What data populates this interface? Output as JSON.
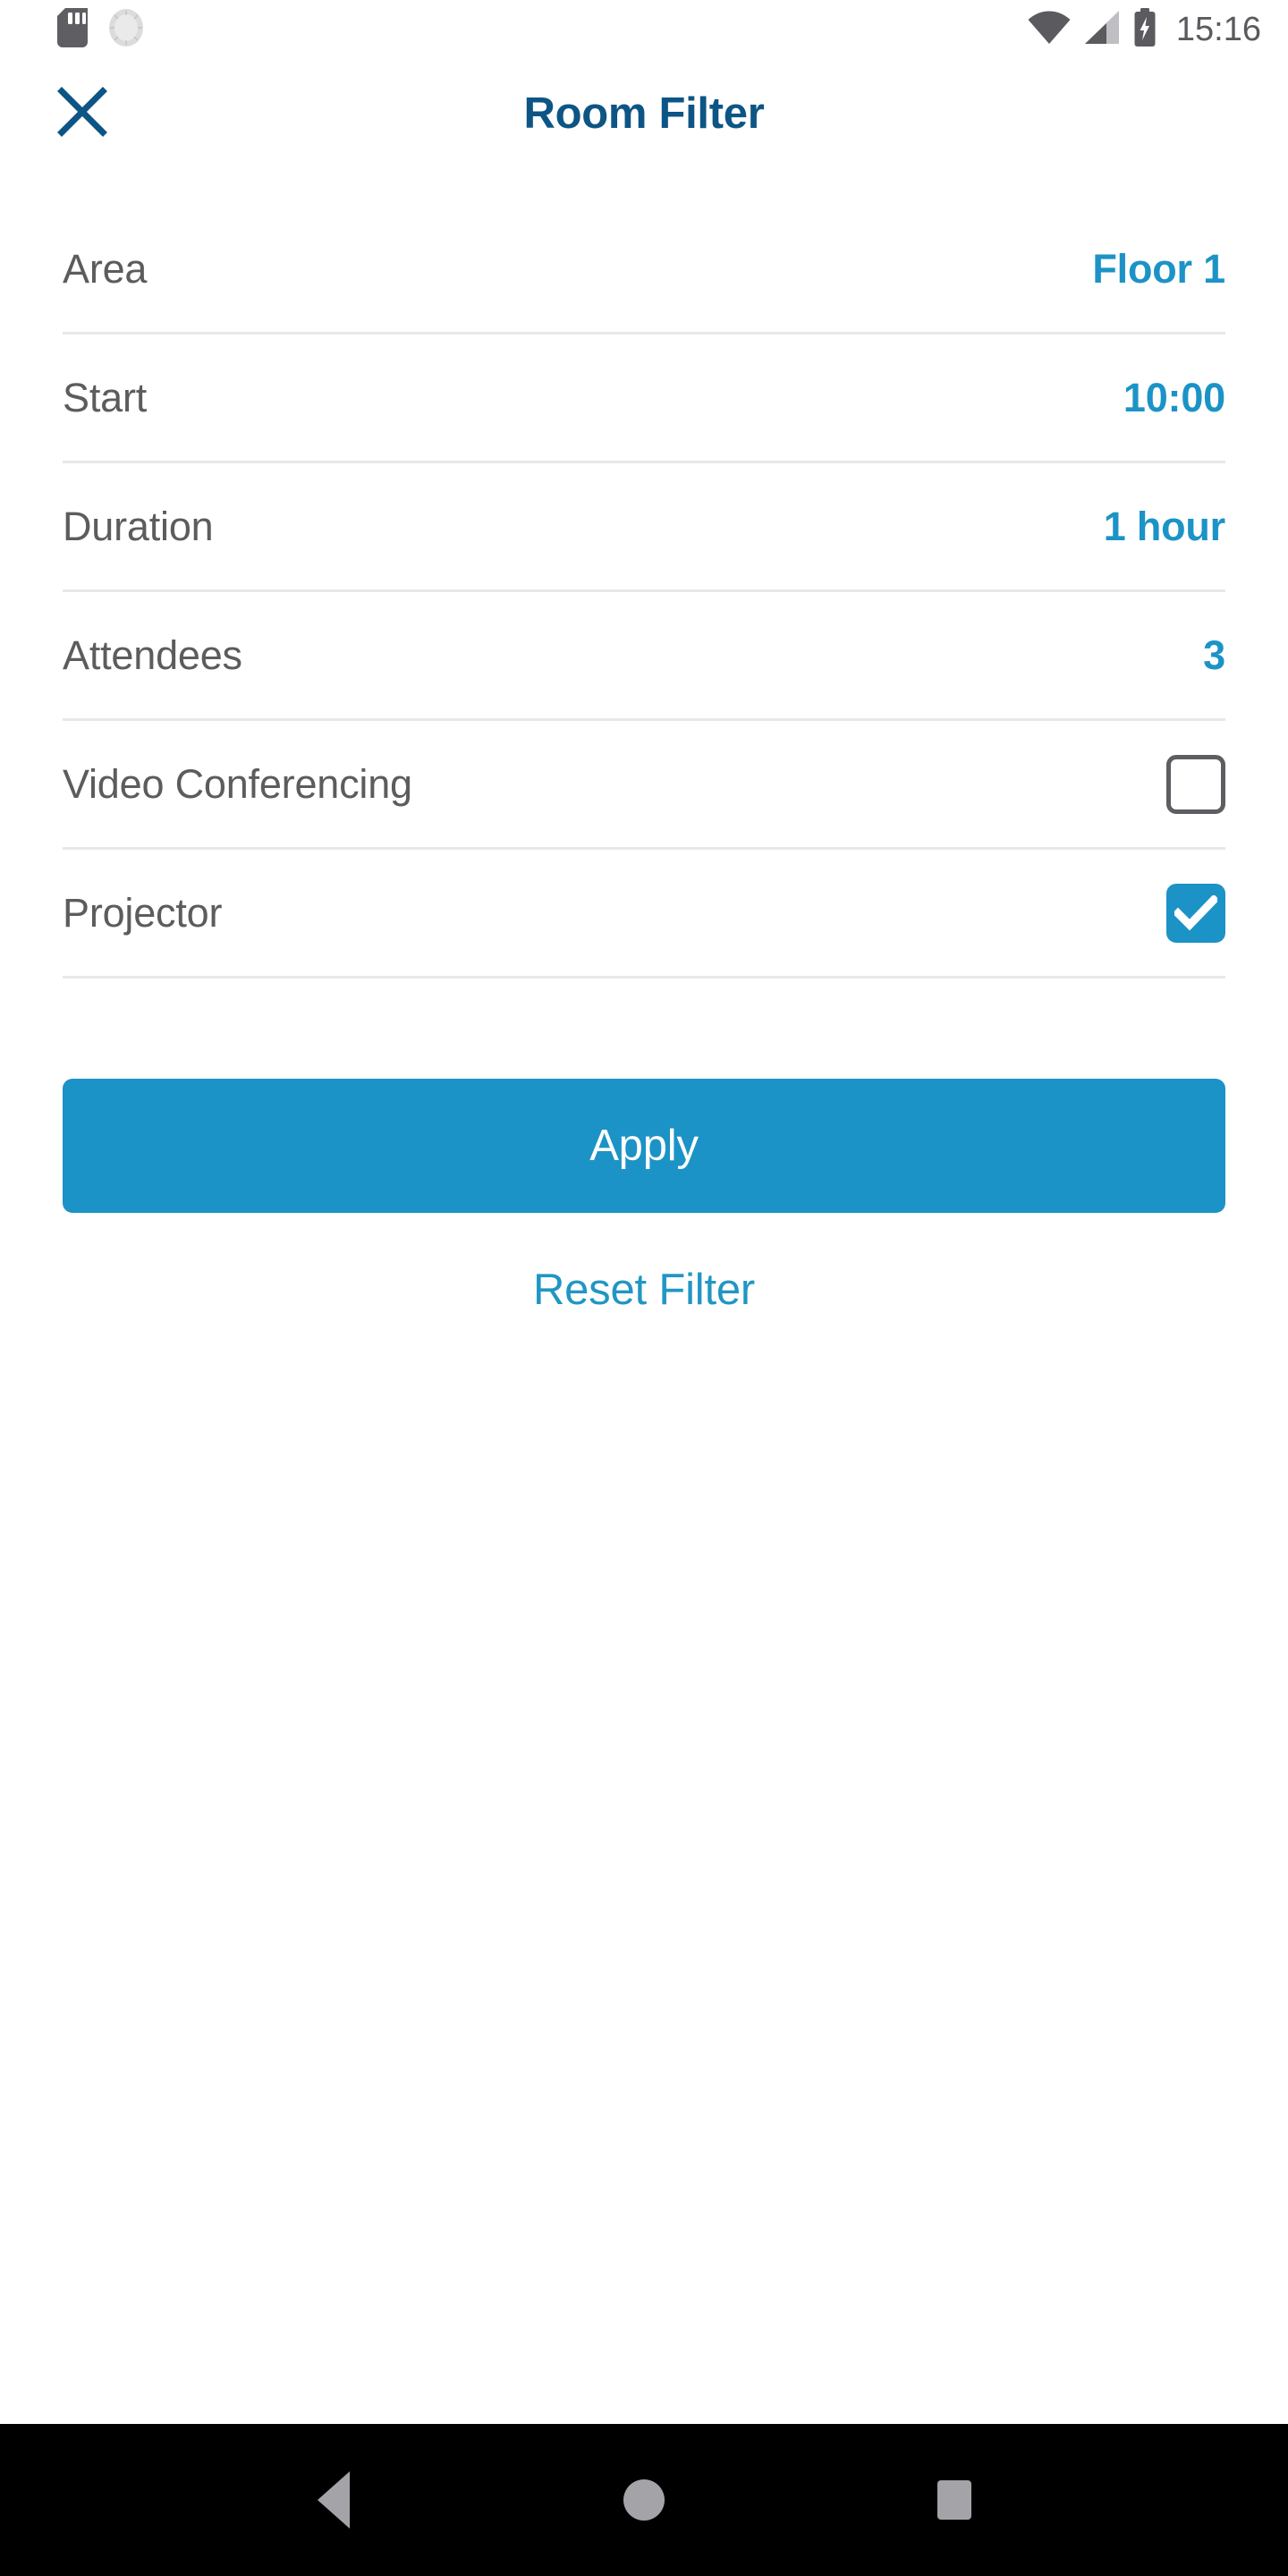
{
  "status_bar": {
    "time": "15:16",
    "icons": [
      "sd-card-icon",
      "alarm-clock-icon",
      "wifi-icon",
      "cellular-signal-icon",
      "battery-charging-icon"
    ]
  },
  "header": {
    "title": "Room Filter",
    "close_icon": "close-icon"
  },
  "filters": [
    {
      "label": "Area",
      "value": "Floor 1",
      "type": "value"
    },
    {
      "label": "Start",
      "value": "10:00",
      "type": "value"
    },
    {
      "label": "Duration",
      "value": "1 hour",
      "type": "value"
    },
    {
      "label": "Attendees",
      "value": "3",
      "type": "value"
    },
    {
      "label": "Video Conferencing",
      "value": "",
      "type": "checkbox",
      "checked": false
    },
    {
      "label": "Projector",
      "value": "",
      "type": "checkbox",
      "checked": true
    }
  ],
  "actions": {
    "apply_label": "Apply",
    "reset_label": "Reset Filter"
  },
  "nav_bar": {
    "back": "back-nav-icon",
    "home": "home-nav-icon",
    "recents": "recents-nav-icon"
  },
  "colors": {
    "accent_blue": "#1c93c6",
    "title_blue": "#0d5584",
    "link_blue": "#2196c4",
    "label_gray": "#5c5c5c",
    "divider": "#e8e8e8"
  }
}
